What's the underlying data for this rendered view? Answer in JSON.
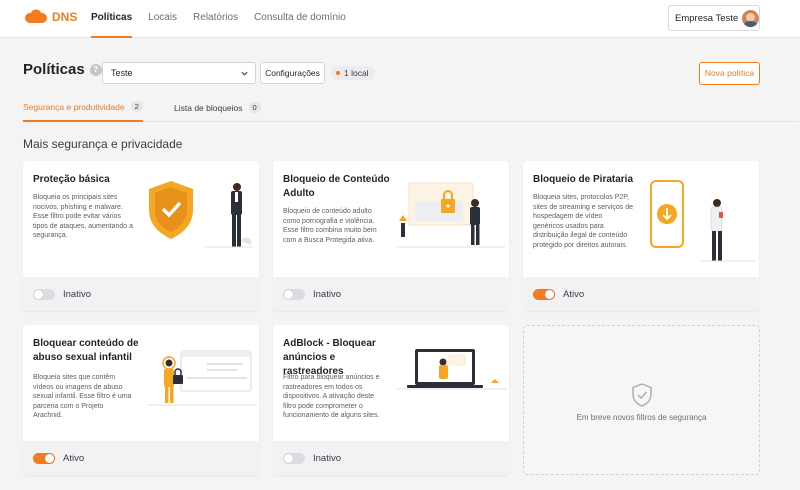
{
  "app": {
    "name": "DNS"
  },
  "nav": [
    {
      "label": "Políticas",
      "active": true
    },
    {
      "label": "Locais"
    },
    {
      "label": "Relatórios"
    },
    {
      "label": "Consulta de domínio"
    }
  ],
  "account": {
    "name": "Empresa Teste"
  },
  "header": {
    "title": "Políticas",
    "help": "?",
    "select_value": "Teste",
    "config_label": "Configurações",
    "local_badge": "1 local",
    "new_button": "Nova política"
  },
  "tabs": [
    {
      "label": "Segurança e produtividade",
      "count": "2",
      "active": true
    },
    {
      "label": "Lista de bloqueios",
      "count": "0"
    }
  ],
  "section_title": "Mais segurança e privacidade",
  "cards": [
    {
      "title": "Proteção básica",
      "desc": [
        "Bloqueia os principais sites",
        "nocivos, phishing e malware.",
        "Esse filtro pode evitar vários",
        "tipos de ataques, aumentando a",
        "segurança."
      ],
      "status": "Inativo",
      "active": false
    },
    {
      "title": "Bloqueio de Conteúdo Adulto",
      "desc": [
        "Bloqueio de conteúdo adulto",
        "como pornografia e violência.",
        "Esse filtro combina muito bem",
        "com a Busca Protegida ativa."
      ],
      "status": "Inativo",
      "active": false
    },
    {
      "title": "Bloqueio de Pirataria",
      "desc": [
        "Bloqueia sites, protocolos P2P,",
        "sites de streaming e serviços de",
        "hospedagem de vídeo",
        "genéricos usados para",
        "distribuição ilegal de conteúdo",
        "protegido por direitos autorais."
      ],
      "status": "Ativo",
      "active": true
    },
    {
      "title": "Bloquear conteúdo de abuso sexual infantil",
      "desc": [
        "Bloqueia sites que contêm",
        "vídeos ou imagens de abuso",
        "sexual infantil. Esse filtro é uma",
        "parceria com o Projeto",
        "Arachnid."
      ],
      "status": "Ativo",
      "active": true
    },
    {
      "title": "AdBlock - Bloquear anúncios e rastreadores",
      "desc": [
        "Filtro para bloquear anúncios e",
        "rastreadores em todos os",
        "dispositivos. A ativação deste",
        "filtro pode comprometer o",
        "funcionamento de alguns sites."
      ],
      "status": "Inativo",
      "active": false
    }
  ],
  "placeholder": {
    "text": "Em breve novos filtros de segurança"
  },
  "colors": {
    "accent": "#f47b20",
    "text": "#1f2328",
    "muted": "#6b6f76",
    "background": "#f4f4f5"
  },
  "icons": [
    "dns-logo-icon",
    "help-icon",
    "chevron-down-icon",
    "shield-check-icon"
  ]
}
